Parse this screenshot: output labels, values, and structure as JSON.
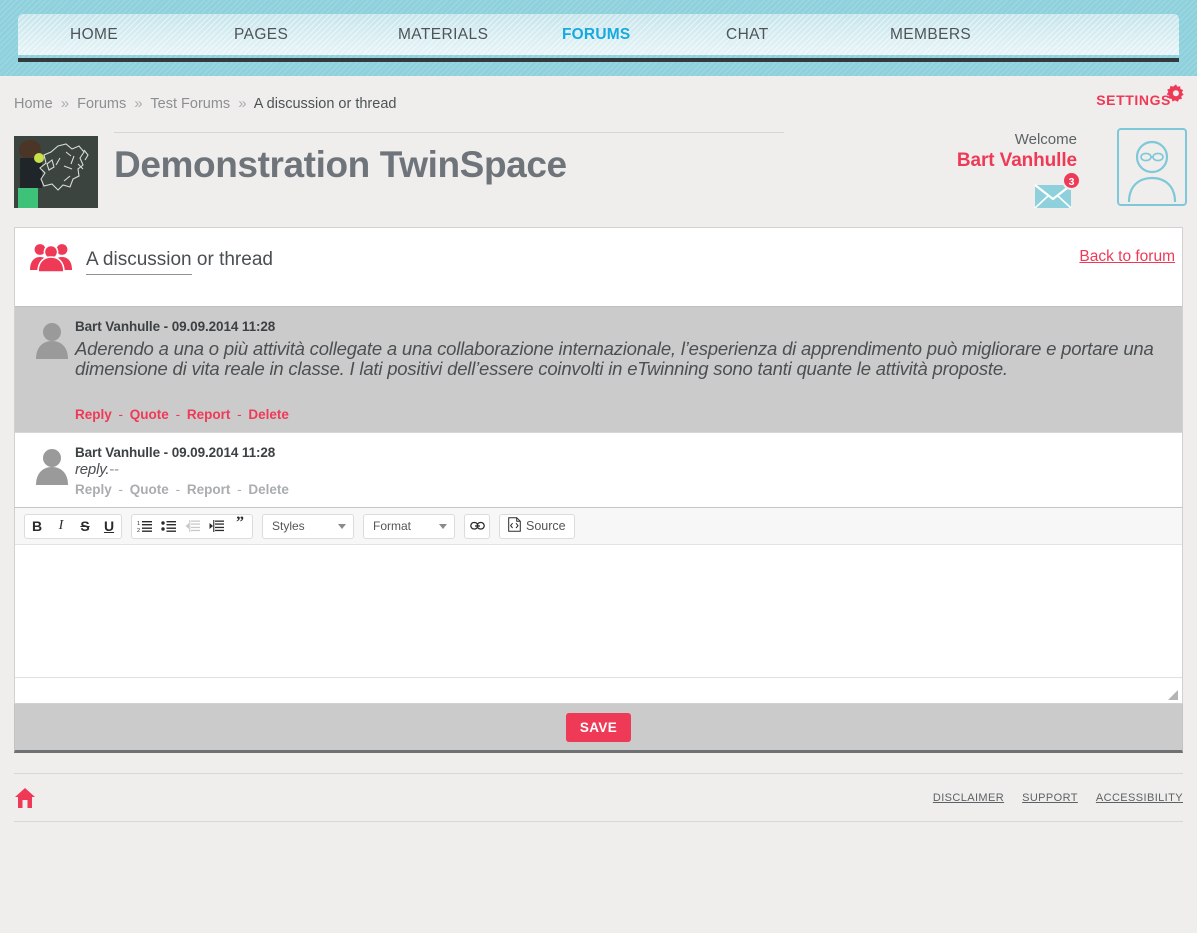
{
  "nav": {
    "items": [
      {
        "label": "HOME",
        "active": false
      },
      {
        "label": "PAGES",
        "active": false
      },
      {
        "label": "MATERIALS",
        "active": false
      },
      {
        "label": "FORUMS",
        "active": true
      },
      {
        "label": "CHAT",
        "active": false
      },
      {
        "label": "MEMBERS",
        "active": false
      }
    ],
    "active_color": "#17a9e0"
  },
  "breadcrumb": {
    "items": [
      "Home",
      "Forums",
      "Test Forums",
      "A discussion or thread"
    ],
    "separator": "»"
  },
  "settings": {
    "label": "SETTINGS",
    "icon": "gear-icon"
  },
  "space": {
    "title": "Demonstration TwinSpace",
    "thumb_alt": "twinspace-thumbnail"
  },
  "user": {
    "welcome_label": "Welcome",
    "name": "Bart Vanhulle",
    "message_count": "3",
    "avatar_icon": "user-avatar-icon",
    "mail_icon": "envelope-icon"
  },
  "thread": {
    "icon": "group-icon",
    "title_underlined": "A discussion",
    "title_rest": " or thread",
    "back_link": "Back to forum"
  },
  "posts": [
    {
      "author": "Bart Vanhulle",
      "separator": "-",
      "timestamp": "09.09.2014 11:28",
      "body": "Aderendo a una o più attività collegate a una collaborazione internazionale, l’esperienza di apprendimento può migliorare e portare una dimensione di vita reale in classe. I lati positivi dell’essere coinvolti in eTwinning sono tanti quante le attività proposte.",
      "body_suffix": "",
      "actions": [
        "Reply",
        "Quote",
        "Report",
        "Delete"
      ],
      "action_separator": "-"
    },
    {
      "author": "Bart Vanhulle",
      "separator": "-",
      "timestamp": "09.09.2014 11:28",
      "body": "reply.",
      "body_suffix": "--",
      "actions": [
        "Reply",
        "Quote",
        "Report",
        "Delete"
      ],
      "action_separator": "-"
    }
  ],
  "editor": {
    "toolbar": {
      "bold": "B",
      "italic": "I",
      "strike": "S",
      "underline": "U",
      "numbered_list_icon": "numbered-list-icon",
      "bulleted_list_icon": "bulleted-list-icon",
      "outdent_icon": "outdent-icon",
      "indent_icon": "indent-icon",
      "blockquote": "”",
      "styles_label": "Styles",
      "format_label": "Format",
      "link_icon": "link-icon",
      "source_label": "Source",
      "source_icon": "source-document-icon"
    },
    "content": "",
    "placeholder": ""
  },
  "save": {
    "label": "SAVE",
    "color": "#ef3a57"
  },
  "footer": {
    "home_icon": "home-icon",
    "links": [
      "DISCLAIMER",
      "SUPPORT",
      "ACCESSIBILITY"
    ]
  }
}
